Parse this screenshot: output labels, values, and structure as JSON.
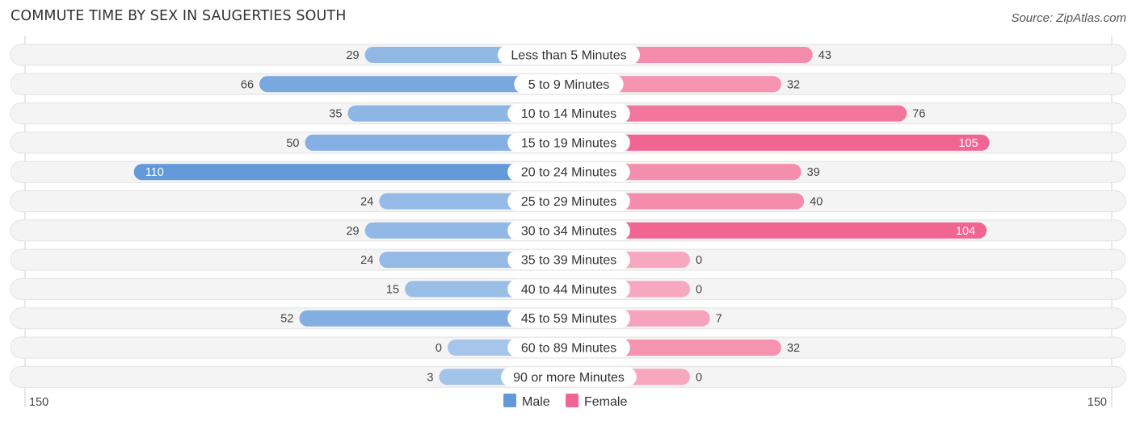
{
  "header": {
    "title": "COMMUTE TIME BY SEX IN SAUGERTIES SOUTH",
    "source": "Source: ZipAtlas.com"
  },
  "colors": {
    "male_strong": "#6399d9",
    "male_light": "#a5c5ea",
    "female_strong": "#f06591",
    "female_light": "#f7a8c0"
  },
  "chart_data": {
    "type": "bar",
    "orientation": "horizontal-diverging",
    "title": "COMMUTE TIME BY SEX IN SAUGERTIES SOUTH",
    "categories": [
      "Less than 5 Minutes",
      "5 to 9 Minutes",
      "10 to 14 Minutes",
      "15 to 19 Minutes",
      "20 to 24 Minutes",
      "25 to 29 Minutes",
      "30 to 34 Minutes",
      "35 to 39 Minutes",
      "40 to 44 Minutes",
      "45 to 59 Minutes",
      "60 to 89 Minutes",
      "90 or more Minutes"
    ],
    "series": [
      {
        "name": "Male",
        "side": "left",
        "values": [
          29,
          66,
          35,
          50,
          110,
          24,
          29,
          24,
          15,
          52,
          0,
          3
        ]
      },
      {
        "name": "Female",
        "side": "right",
        "values": [
          43,
          32,
          76,
          105,
          39,
          40,
          104,
          0,
          0,
          7,
          32,
          0
        ]
      }
    ],
    "axis": {
      "left_label": "150",
      "right_label": "150",
      "max": 150
    },
    "legend": {
      "position": "bottom-center",
      "entries": [
        "Male",
        "Female"
      ]
    },
    "grid": false
  }
}
